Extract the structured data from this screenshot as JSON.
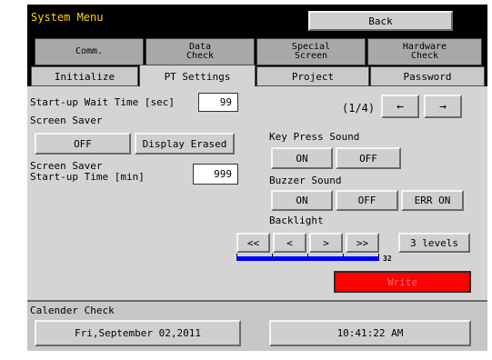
{
  "title": "System Menu",
  "back_label": "Back",
  "top_tabs": [
    "Comm.",
    "Data\nCheck",
    "Special\nScreen",
    "Hardware\nCheck"
  ],
  "lower_tabs": [
    "Initialize",
    "PT Settings",
    "Project",
    "Password"
  ],
  "active_tab": "PT Settings",
  "startup_wait": {
    "label": "Start-up Wait Time [sec]",
    "value": "99"
  },
  "screen_saver": {
    "label": "Screen Saver",
    "off_label": "OFF",
    "erased_label": "Display Erased"
  },
  "saver_time": {
    "label": "Screen Saver\nStart-up Time [min]",
    "value": "999"
  },
  "page_indicator": "(1/4)",
  "nav": {
    "prev": "←",
    "next": "→"
  },
  "key_press": {
    "label": "Key Press Sound",
    "on": "ON",
    "off": "OFF"
  },
  "buzzer": {
    "label": "Buzzer Sound",
    "on": "ON",
    "off": "OFF",
    "err_on": "ERR ON"
  },
  "backlight": {
    "label": "Backlight",
    "first": "<<",
    "prev": "<",
    "next": ">",
    "last": ">>",
    "levels": "3 levels",
    "value": "32"
  },
  "write_label": "Write",
  "calendar": {
    "label": "Calender Check",
    "date": "Fri,September 02,2011",
    "time": "10:41:22 AM"
  },
  "colors": {
    "title": "#ffd400",
    "write": "#ff0000",
    "bar": "#0000ff"
  }
}
